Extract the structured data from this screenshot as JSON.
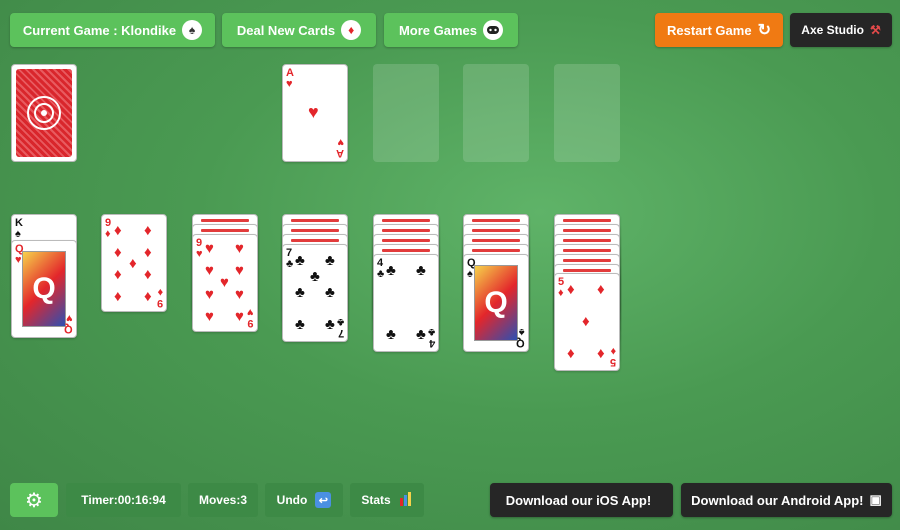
{
  "toolbar": {
    "current_game": "Current Game : Klondike",
    "deal_new": "Deal New Cards",
    "more_games": "More Games",
    "restart": "Restart Game",
    "studio": "Axe Studio"
  },
  "foundation": {
    "card1": {
      "rank": "A",
      "suit": "♥"
    }
  },
  "tableau": {
    "col1": {
      "top": {
        "rank": "K",
        "suit": "♠"
      },
      "face": {
        "rank": "Q",
        "suit": "♥"
      }
    },
    "col2": {
      "rank": "9",
      "suit": "♦"
    },
    "col3": {
      "rank": "9",
      "suit": "♥"
    },
    "col4": {
      "rank": "7",
      "suit": "♣"
    },
    "col5": {
      "rank": "4",
      "suit": "♣"
    },
    "col6": {
      "rank": "Q",
      "suit": "♠"
    },
    "col7": {
      "rank": "5",
      "suit": "♦"
    }
  },
  "status": {
    "timer": "Timer:00:16:94",
    "moves": "Moves:3",
    "undo": "Undo",
    "stats": "Stats"
  },
  "apps": {
    "ios": "Download our iOS App!",
    "android": "Download our Android App!"
  },
  "icons": {
    "spade": "♠",
    "diamond": "♦",
    "gear": "⚙",
    "apple": "",
    "android": "▣",
    "restart": "↻",
    "hammer": "⚒"
  }
}
